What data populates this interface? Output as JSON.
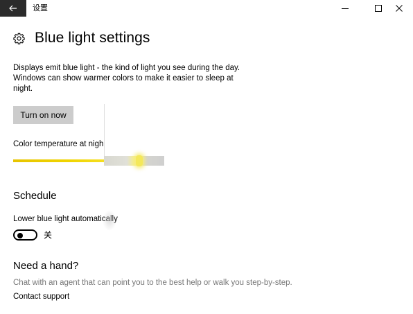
{
  "titlebar": {
    "app_title": "设置",
    "back_icon": "back-arrow-icon",
    "minimize_icon": "minimize-icon",
    "maximize_icon": "maximize-icon",
    "close_icon": "close-icon",
    "back_bg": "#2b2b2b"
  },
  "page": {
    "title": "Blue light settings",
    "icon": "gear-icon",
    "description": "Displays emit blue light - the kind of light you see during the day. Windows can show warmer colors to make it easier to sleep at night."
  },
  "turn_on": {
    "label": "Turn on now"
  },
  "color_temperature": {
    "label": "Color temperature at nigh",
    "accent": "#f0d400"
  },
  "schedule": {
    "heading": "Schedule",
    "auto_label": "Lower blue light automatically",
    "toggle_state": "关",
    "toggle_on": false
  },
  "help": {
    "heading": "Need a hand?",
    "description": "Chat with an agent that can point you to the best help or walk you step-by-step.",
    "contact_link": "Contact support"
  }
}
